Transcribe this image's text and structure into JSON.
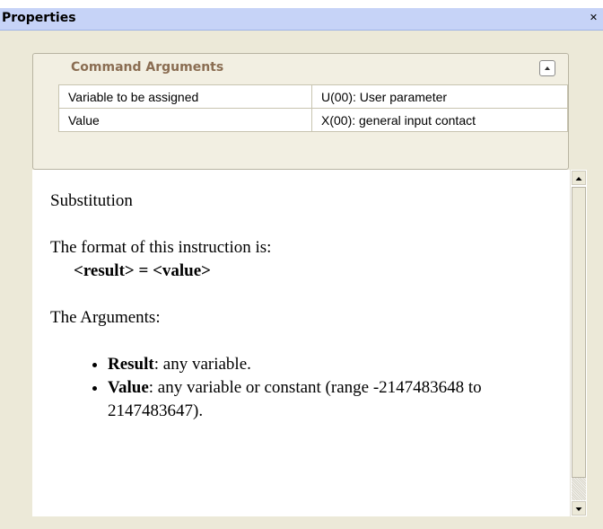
{
  "window": {
    "title": "Properties",
    "close_icon": "close-icon"
  },
  "arguments": {
    "title": "Command Arguments",
    "collapse_icon": "chevron-up-icon",
    "rows": [
      {
        "name": "Variable to be assigned",
        "value": "U(00): User parameter"
      },
      {
        "name": "Value",
        "value": "X(00): general input contact"
      }
    ]
  },
  "help": {
    "heading": "Substitution",
    "format_intro": "The format of this instruction is:",
    "format_result": "<result>",
    "format_equals": " = ",
    "format_value": "<value>",
    "args_heading": "The Arguments:",
    "bullets": [
      {
        "term": "Result",
        "text": ": any variable."
      },
      {
        "term": "Value",
        "text": ": any variable or constant (range -2147483648 to 2147483647)."
      }
    ]
  },
  "colors": {
    "titlebar": "#c6d3f7",
    "panel_bg": "#ece9d8",
    "group_title": "#8a6d52"
  }
}
